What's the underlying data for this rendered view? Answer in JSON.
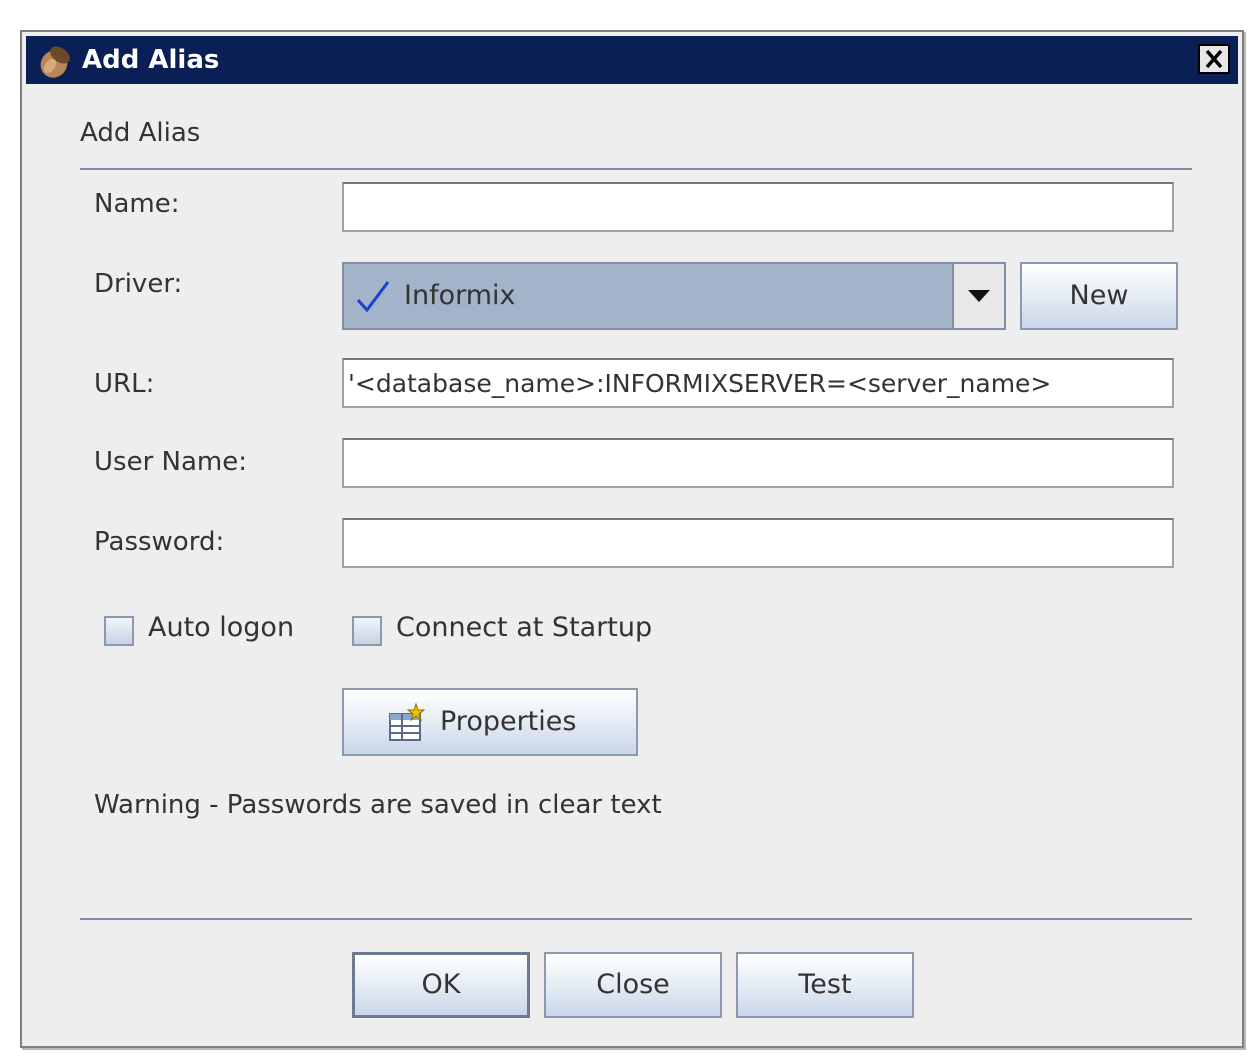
{
  "window": {
    "title": "Add Alias",
    "icons": {
      "app": "acorn-icon",
      "close": "close-icon"
    }
  },
  "form": {
    "section_title": "Add Alias",
    "name": {
      "label": "Name:",
      "value": ""
    },
    "driver": {
      "label": "Driver:",
      "selected": "Informix",
      "new_button": "New"
    },
    "url": {
      "label": "URL:",
      "value": "'<database_name>:INFORMIXSERVER=<server_name>"
    },
    "user_name": {
      "label": "User Name:",
      "value": ""
    },
    "password": {
      "label": "Password:",
      "value": ""
    },
    "auto_logon": {
      "label": "Auto logon",
      "checked": false
    },
    "connect_at_startup": {
      "label": "Connect at Startup",
      "checked": false
    },
    "properties_button": "Properties",
    "warning": "Warning - Passwords are saved in clear text"
  },
  "buttons": {
    "ok": "OK",
    "close": "Close",
    "test": "Test"
  },
  "colors": {
    "titlebar": "#0a1f55",
    "dialog_bg": "#eeeeee",
    "combo_bg": "#a3b3c9",
    "check_mark": "#1f3fcf"
  }
}
